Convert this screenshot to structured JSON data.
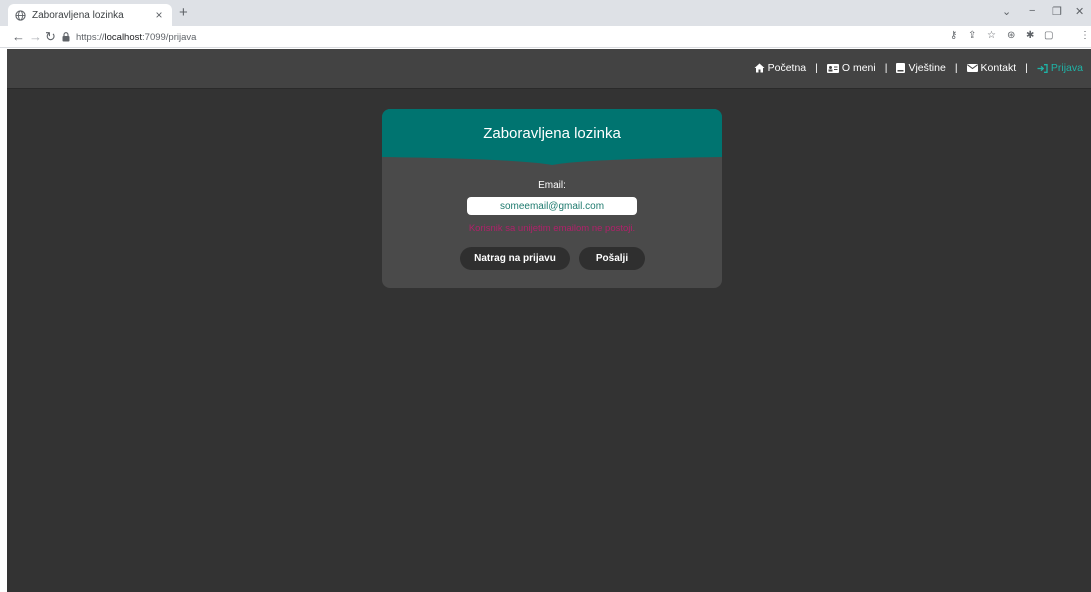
{
  "browser": {
    "tab_title": "Zaboravljena lozinka",
    "tab_close": "×",
    "new_tab": "+",
    "url_scheme": "https://",
    "url_host": "localhost",
    "url_rest": ":7099/prijava",
    "window_controls": {
      "minimize": "−",
      "maximize": "❐",
      "close": "✕",
      "tabsearch": "⌄"
    },
    "profile_initial": "T",
    "profile_color": "#e8541f"
  },
  "navbar": {
    "items": [
      {
        "label": "Početna",
        "icon": "home-icon"
      },
      {
        "label": "O meni",
        "icon": "id-card-icon"
      },
      {
        "label": "Vještine",
        "icon": "book-icon"
      },
      {
        "label": "Kontakt",
        "icon": "envelope-icon"
      },
      {
        "label": "Prijava",
        "icon": "sign-in-icon",
        "active": true
      }
    ],
    "separator": "|",
    "active_color": "#1fb3a6"
  },
  "card": {
    "title": "Zaboravljena lozinka",
    "email_label": "Email:",
    "email_value": "someemail@gmail.com",
    "message": "Korisnik sa unijetim emailom ne postoji.",
    "back_button": "Natrag na prijavu",
    "send_button": "Pošalji",
    "header_color": "#007470"
  }
}
